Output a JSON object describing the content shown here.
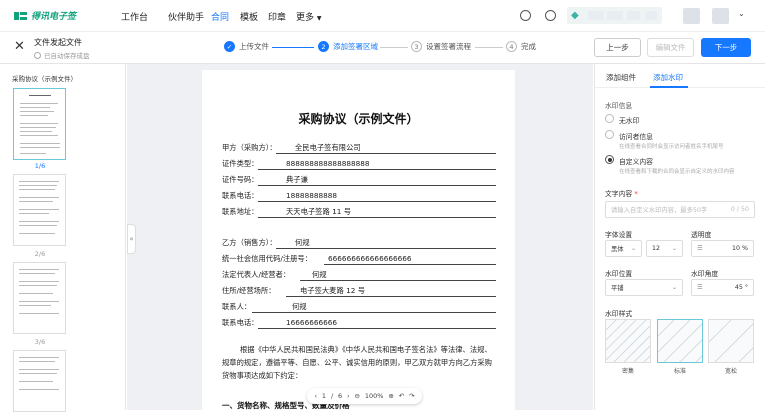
{
  "top": {
    "logo_text": "得讯电子签",
    "nav": [
      "工作台",
      "伙伴助手",
      "合同",
      "模板",
      "印章",
      "更多"
    ],
    "active_nav": "合同"
  },
  "sub": {
    "title": "文件发起文件",
    "autosave": "已自动保存成盘",
    "steps": [
      {
        "num": "✓",
        "label": "上传文件"
      },
      {
        "num": "2",
        "label": "添加签署区域"
      },
      {
        "num": "3",
        "label": "设置签署流程"
      },
      {
        "num": "4",
        "label": "完成"
      }
    ],
    "prev": "上一步",
    "edit": "编辑文件",
    "next": "下一步"
  },
  "left": {
    "doc_title": "采购协议（示例文件）",
    "pages": [
      "1/6",
      "2/6",
      "3/6"
    ]
  },
  "doc": {
    "title": "采购协议（示例文件）",
    "partyA": {
      "l1": "甲方（采购方）：",
      "v1": "全民电子签有限公司",
      "l2": "证件类型：",
      "v2": "888888888888888888",
      "l3": "证件号码：",
      "v3": "典子谦",
      "l4": "联系电话：",
      "v4": "18888888888",
      "l5": "联系地址：",
      "v5": "天天电子签路 11 号"
    },
    "partyB": {
      "l1": "乙方（销售方）：",
      "v1": "何规",
      "l2": "统一社会信用代码/注册号：",
      "v2": "666666666666666666",
      "l3": "法定代表人/经营者：",
      "v3": "何规",
      "l4": "住所/经营场所：",
      "v4": "电子签大麦路 12 号",
      "l5": "联系人：",
      "v5": "何规",
      "l6": "联系电话：",
      "v6": "16666666666"
    },
    "para": "根据《中华人民共和国民法典》《中华人民共和国电子签名法》等法律、法规、规章的规定，遵循平等、自愿、公平、诚实信用的原则，甲乙双方就甲方向乙方采购货物事项达成如下约定：",
    "section": "一、货物名称、规格型号、数量及价格"
  },
  "pager": {
    "current": "1",
    "sep": "/",
    "total": "6",
    "zoom": "100%"
  },
  "right": {
    "tabs": [
      "添加组件",
      "添加水印"
    ],
    "active_tab": "添加水印",
    "wm_info_label": "水印信息",
    "options": [
      {
        "label": "无水印",
        "desc": ""
      },
      {
        "label": "访问者信息",
        "desc": "在线查看合同时会显示访问者姓名手机尾号"
      },
      {
        "label": "自定义内容",
        "desc": "在线查看和下载的合同会显示自定义的水印内容"
      }
    ],
    "selected_option": 2,
    "text_label": "文字内容",
    "text_required": "*",
    "text_placeholder": "请输入自定义水印内容，最多50字",
    "text_counter": "0 / 50",
    "font_label": "字体设置",
    "opacity_label": "透明度",
    "font_name": "黑体",
    "font_size": "12",
    "opacity_value": "10",
    "opacity_unit": "%",
    "pos_label": "水印位置",
    "angle_label": "水印角度",
    "pos_value": "平铺",
    "angle_value": "45",
    "angle_unit": "°",
    "style_label": "水印样式",
    "styles": [
      "密集",
      "标准",
      "宽松"
    ],
    "selected_style": 1
  }
}
